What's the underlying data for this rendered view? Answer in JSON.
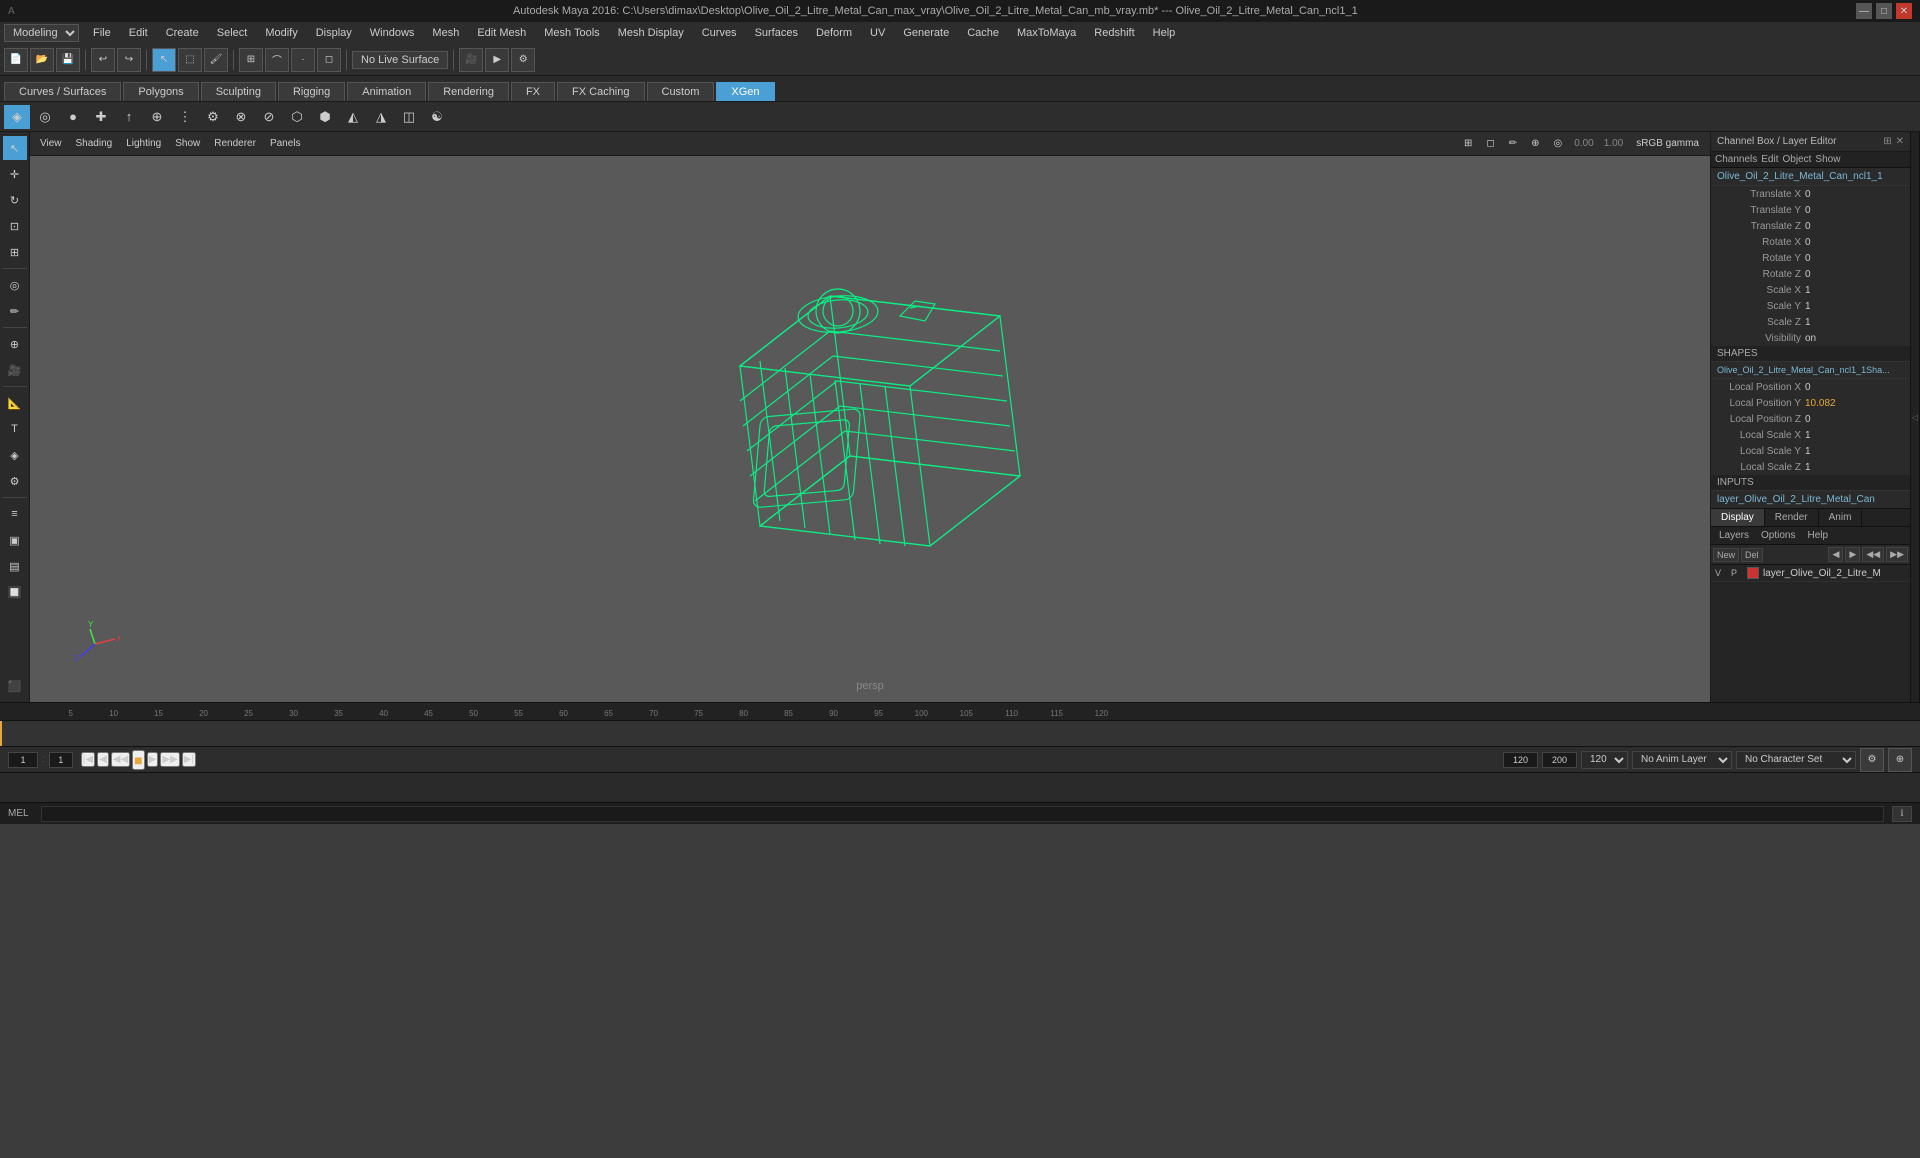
{
  "titleBar": {
    "text": "Autodesk Maya 2016: C:\\Users\\dimax\\Desktop\\Olive_Oil_2_Litre_Metal_Can_max_vray\\Olive_Oil_2_Litre_Metal_Can_mb_vray.mb* --- Olive_Oil_2_Litre_Metal_Can_ncl1_1",
    "minimizeLabel": "—",
    "maximizeLabel": "□",
    "closeLabel": "✕"
  },
  "menuBar": {
    "modeSelector": "Modeling",
    "items": [
      "File",
      "Edit",
      "Create",
      "Select",
      "Modify",
      "Display",
      "Windows",
      "Mesh",
      "Edit Mesh",
      "Mesh Tools",
      "Mesh Display",
      "Curves",
      "Surfaces",
      "Deform",
      "UV",
      "Generate",
      "Cache",
      "MaxToMaya",
      "Redshift",
      "Help"
    ]
  },
  "toolbar": {
    "noLiveSurface": "No Live Surface"
  },
  "tabs": {
    "items": [
      "Curves / Surfaces",
      "Polygons",
      "Sculpting",
      "Rigging",
      "Animation",
      "Rendering",
      "FX",
      "FX Caching",
      "Custom",
      "XGen"
    ],
    "activeIndex": 9
  },
  "viewport": {
    "cameraLabel": "persp",
    "gamma": "sRGB gamma",
    "value1": "0.00",
    "value2": "1.00"
  },
  "rightPanel": {
    "header": "Channel Box / Layer Editor",
    "channels": "Channels",
    "edit": "Edit",
    "object": "Object",
    "show": "Show",
    "objectName": "Olive_Oil_2_Litre_Metal_Can_ncl1_1",
    "properties": [
      {
        "label": "Translate X",
        "value": "0"
      },
      {
        "label": "Translate Y",
        "value": "0"
      },
      {
        "label": "Translate Z",
        "value": "0"
      },
      {
        "label": "Rotate X",
        "value": "0"
      },
      {
        "label": "Rotate Y",
        "value": "0"
      },
      {
        "label": "Rotate Z",
        "value": "0"
      },
      {
        "label": "Scale X",
        "value": "1"
      },
      {
        "label": "Scale Y",
        "value": "1"
      },
      {
        "label": "Scale Z",
        "value": "1"
      },
      {
        "label": "Visibility",
        "value": "on"
      }
    ],
    "shapesLabel": "SHAPES",
    "shapeName": "Olive_Oil_2_Litre_Metal_Can_ncl1_1Sha...",
    "shapeProperties": [
      {
        "label": "Local Position X",
        "value": "0"
      },
      {
        "label": "Local Position Y",
        "value": "10.082"
      },
      {
        "label": "Local Position Z",
        "value": "0"
      },
      {
        "label": "Local Scale X",
        "value": "1"
      },
      {
        "label": "Local Scale Y",
        "value": "1"
      },
      {
        "label": "Local Scale Z",
        "value": "1"
      }
    ],
    "inputsLabel": "INPUTS",
    "inputName": "layer_Olive_Oil_2_Litre_Metal_Can",
    "bottomTabs": [
      "Display",
      "Render",
      "Anim"
    ],
    "activeBottomTab": "Display",
    "layerOptions": [
      "Layers",
      "Options",
      "Help"
    ],
    "layers": [
      {
        "v": "V",
        "p": "P",
        "color": "#cc3333",
        "name": "layer_Olive_Oil_2_Litre_M"
      }
    ]
  },
  "timeline": {
    "ticks": [
      "5",
      "10",
      "15",
      "20",
      "25",
      "30",
      "35",
      "40",
      "45",
      "50",
      "55",
      "60",
      "65",
      "70",
      "75",
      "80",
      "85",
      "90",
      "95",
      "100",
      "105",
      "110",
      "115",
      "120"
    ],
    "currentFrame": "1",
    "startFrame": "1",
    "endFrame": "120",
    "rangeEnd": "200",
    "playbackSpeed": "120",
    "animLayer": "No Anim Layer",
    "characterSet": "No Character Set",
    "playBtn": "▶",
    "prevBtn": "◀◀",
    "nextBtn": "▶▶",
    "stepBackBtn": "◀",
    "stepFwdBtn": "▶",
    "firstBtn": "|◀",
    "lastBtn": "▶|"
  },
  "statusBar": {
    "melLabel": "MEL",
    "helpText": ""
  },
  "leftSidebar": {
    "tools": [
      "↖",
      "↔",
      "↕",
      "✏",
      "◎",
      "↩",
      "⊕",
      "⊗",
      "◈",
      "◉",
      "⚙",
      "≡",
      "▣",
      "▤",
      "🔲"
    ]
  }
}
